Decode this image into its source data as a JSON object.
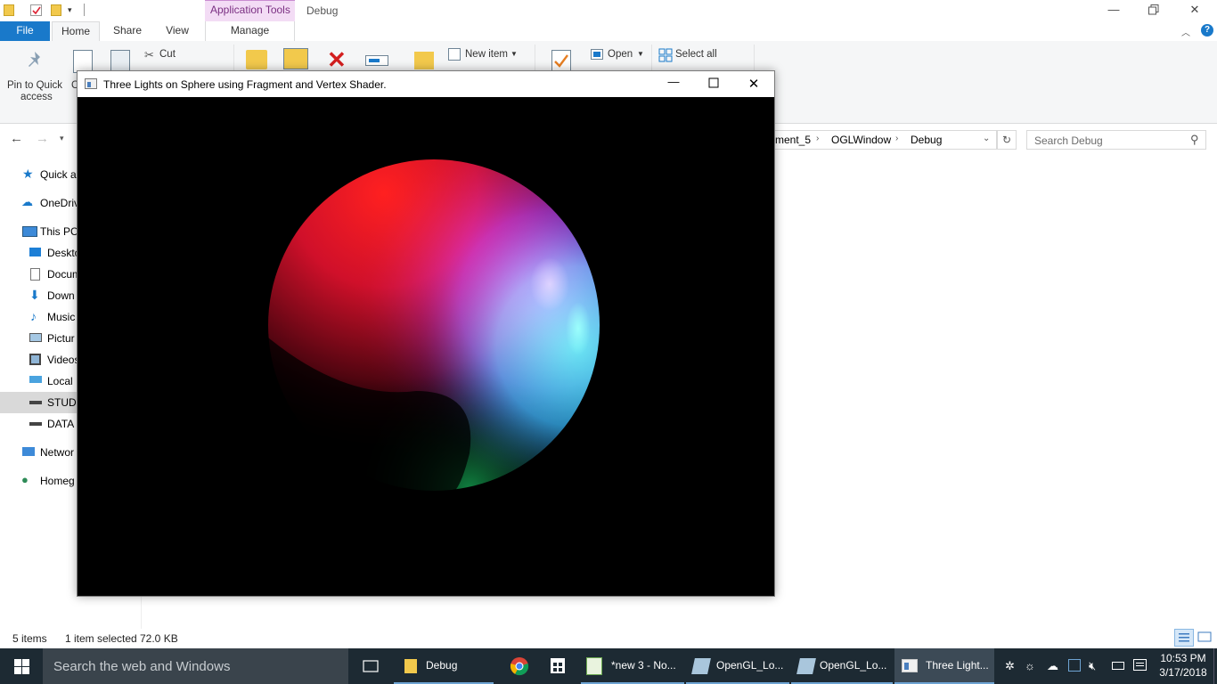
{
  "explorer": {
    "title": "Debug",
    "context_tab": "Application Tools",
    "tabs": {
      "file": "File",
      "home": "Home",
      "share": "Share",
      "view": "View",
      "manage": "Manage"
    },
    "ribbon": {
      "pin_label_1": "Pin to Quick",
      "pin_label_2": "access",
      "copy_partial": "C",
      "cut": "Cut",
      "new_item": "New item",
      "open": "Open",
      "select_all": "Select all"
    },
    "breadcrumb": [
      "ment_5",
      "OGLWindow",
      "Debug"
    ],
    "search_placeholder": "Search Debug",
    "nav": [
      {
        "label": "Quick a",
        "icon": "star-icon"
      },
      {
        "label": "OneDriv",
        "icon": "cloud-icon"
      },
      {
        "label": "This PC",
        "icon": "computer-icon"
      },
      {
        "label": "Deskto",
        "icon": "desktop-icon"
      },
      {
        "label": "Docum",
        "icon": "document-icon"
      },
      {
        "label": "Down",
        "icon": "download-icon"
      },
      {
        "label": "Music",
        "icon": "music-icon"
      },
      {
        "label": "Pictur",
        "icon": "pictures-icon"
      },
      {
        "label": "Videos",
        "icon": "video-icon"
      },
      {
        "label": "Local",
        "icon": "drive-icon"
      },
      {
        "label": "STUDY",
        "icon": "drive-icon"
      },
      {
        "label": "DATA",
        "icon": "drive-icon"
      },
      {
        "label": "Networ",
        "icon": "network-icon"
      },
      {
        "label": "Homeg",
        "icon": "homegroup-icon"
      }
    ],
    "status": {
      "items": "5 items",
      "selected": "1 item selected",
      "size": "72.0 KB"
    }
  },
  "gl_window": {
    "title": "Three Lights on Sphere using Fragment and Vertex Shader."
  },
  "taskbar": {
    "search": "Search the web and Windows",
    "apps": [
      {
        "label": "Debug"
      },
      {
        "label": "*new 3 - No..."
      },
      {
        "label": "OpenGL_Lo..."
      },
      {
        "label": "OpenGL_Lo..."
      },
      {
        "label": "Three Light..."
      }
    ],
    "time": "10:53 PM",
    "date": "3/17/2018"
  },
  "colors": {
    "accent": "#1979ca",
    "taskbar": "#1d2a33",
    "context_tab": "#f3dcf5"
  }
}
